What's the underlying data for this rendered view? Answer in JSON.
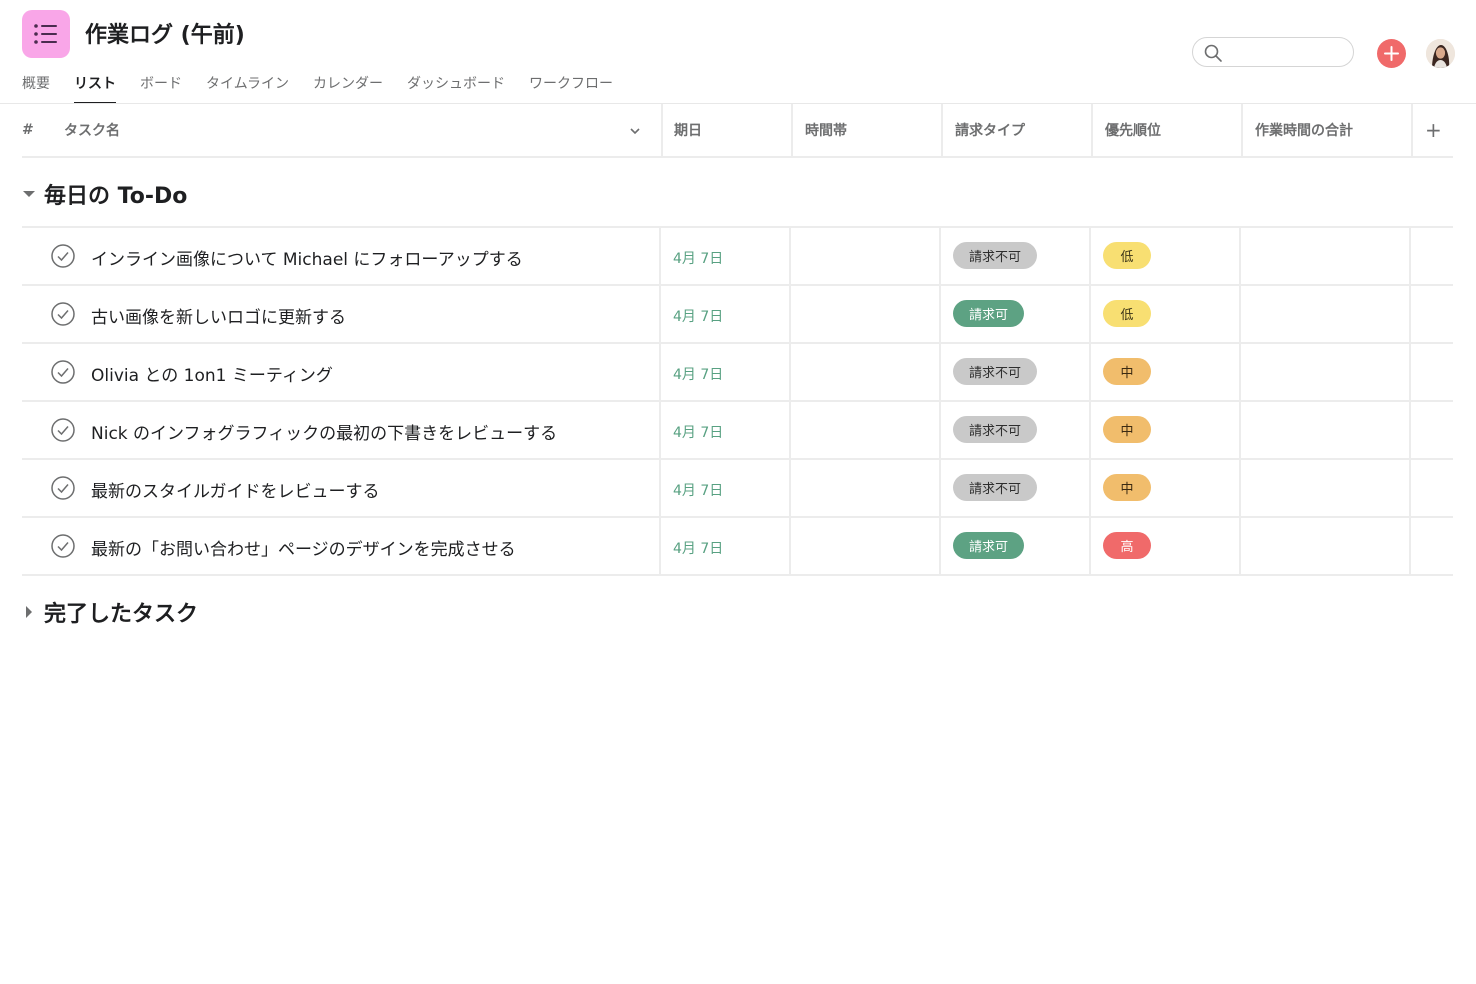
{
  "project": {
    "title": "作業ログ (午前)",
    "icon": "list-icon",
    "icon_color": "#f9a6e8"
  },
  "tabs": [
    {
      "label": "概要"
    },
    {
      "label": "リスト"
    },
    {
      "label": "ボード"
    },
    {
      "label": "タイムライン"
    },
    {
      "label": "カレンダー"
    },
    {
      "label": "ダッシュボード"
    },
    {
      "label": "ワークフロー"
    }
  ],
  "active_tab": "リスト",
  "search": {
    "value": "",
    "placeholder": ""
  },
  "columns": {
    "number": "#",
    "task_name": "タスク名",
    "due_date": "期日",
    "time_slot": "時間帯",
    "billing_type": "請求タイプ",
    "priority": "優先順位",
    "total_time": "作業時間の合計",
    "add": "+"
  },
  "sections": [
    {
      "title": "毎日の To-Do",
      "expanded": true
    },
    {
      "title": "完了したタスク",
      "expanded": false
    }
  ],
  "tasks": [
    {
      "name": "インライン画像について Michael にフォローアップする",
      "due": "4月 7日",
      "billing": "請求不可",
      "priority": "低"
    },
    {
      "name": "古い画像を新しいロゴに更新する",
      "due": "4月 7日",
      "billing": "請求可",
      "priority": "低"
    },
    {
      "name": "Olivia との 1on1 ミーティング",
      "due": "4月 7日",
      "billing": "請求不可",
      "priority": "中"
    },
    {
      "name": "Nick のインフォグラフィックの最初の下書きをレビューする",
      "due": "4月 7日",
      "billing": "請求不可",
      "priority": "中"
    },
    {
      "name": "最新のスタイルガイドをレビューする",
      "due": "4月 7日",
      "billing": "請求不可",
      "priority": "中"
    },
    {
      "name": "最新の「お問い合わせ」ページのデザインを完成させる",
      "due": "4月 7日",
      "billing": "請求可",
      "priority": "高"
    }
  ],
  "colors": {
    "accent": "#f06a6a",
    "billable": "#5da283",
    "non_billable": "#c9c9c9",
    "priority_low": "#f8df72",
    "priority_medium": "#f1bd6c",
    "priority_high": "#f06a6a",
    "due_date_text": "#58a182"
  }
}
